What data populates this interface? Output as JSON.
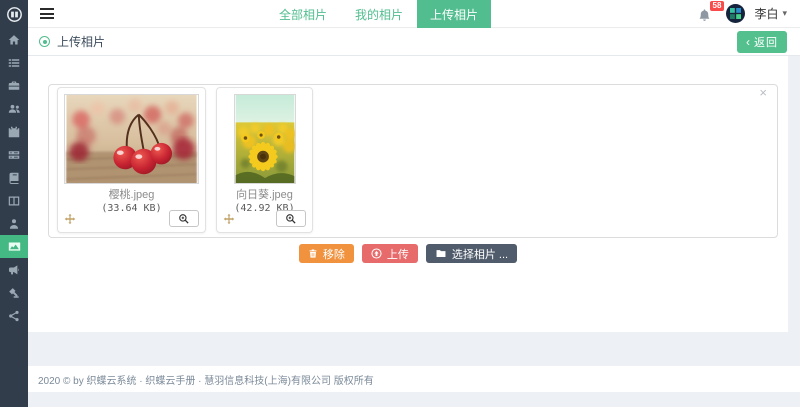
{
  "colors": {
    "accent_green": "#52bd8f",
    "sidebar_bg": "#323d4c",
    "active_item_bg": "#45b984",
    "remove_orange": "#f0923e",
    "upload_red": "#e76b6b",
    "browse_dark": "#505c6b",
    "badge_red": "#fa4b4b"
  },
  "sidebar": {
    "logo_icon": "logo-book-circle-icon",
    "icons": [
      "home-icon",
      "list-icon",
      "briefcase-icon",
      "users-icon",
      "calendar-icon",
      "tasks-icon",
      "book-icon",
      "columns-icon",
      "user-icon",
      "photos-icon",
      "bullhorn-icon",
      "gavel-icon",
      "share-icon"
    ],
    "active_icon": "photos-icon"
  },
  "navbar": {
    "tabs": [
      {
        "label": "全部相片",
        "active": false
      },
      {
        "label": "我的相片",
        "active": false
      },
      {
        "label": "上传相片",
        "active": true
      }
    ],
    "notifications": {
      "badge": "58"
    },
    "user": {
      "name": "李白",
      "caret": "▾"
    }
  },
  "breadcrumb": {
    "title": "上传相片"
  },
  "page_actions": {
    "back_chevron": "‹",
    "back_label": "返回"
  },
  "uploader": {
    "close": "×",
    "files": [
      {
        "name": "樱桃.jpeg",
        "size": "(33.64 KB)"
      },
      {
        "name": "向日葵.jpeg",
        "size": "(42.92 KB)"
      }
    ],
    "actions": {
      "remove": "移除",
      "upload": "上传",
      "browse": "选择相片 ..."
    }
  },
  "footer": {
    "copyright": "2020 © by 织蝶云系统 · 织蝶云手册 · 慧羽信息科技(上海)有限公司 版权所有"
  }
}
